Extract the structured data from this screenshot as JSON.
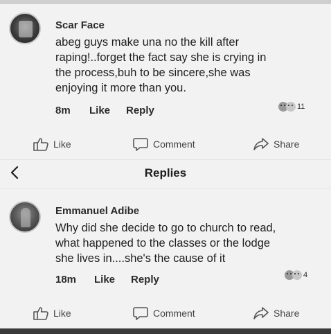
{
  "comment": {
    "author": "Scar Face",
    "lines": [
      "abeg guys make una no the kill after",
      "raping!..forget the fact say she is crying in",
      "the process,buh to be sincere,she was",
      "enjoying it more than you."
    ],
    "time": "8m",
    "like_label": "Like",
    "reply_label": "Reply",
    "reaction_count": "11"
  },
  "action_bar_1": {
    "like": "Like",
    "comment": "Comment",
    "share": "Share"
  },
  "replies_header": {
    "title": "Replies"
  },
  "reply": {
    "author": "Emmanuel Adibe",
    "lines": [
      "Why did she decide to go to church to read,",
      "what happened to the classes or the lodge",
      "she lives in....she's the cause of it"
    ],
    "time": "18m",
    "like_label": "Like",
    "reply_label": "Reply",
    "reaction_count": "4"
  },
  "action_bar_2": {
    "like": "Like",
    "comment": "Comment",
    "share": "Share"
  },
  "icons": {
    "like": "thumbs-up-icon",
    "comment": "comment-bubble-icon",
    "share": "share-arrow-icon",
    "back": "back-arrow-icon",
    "reactions": "reaction-emoji-icon"
  }
}
